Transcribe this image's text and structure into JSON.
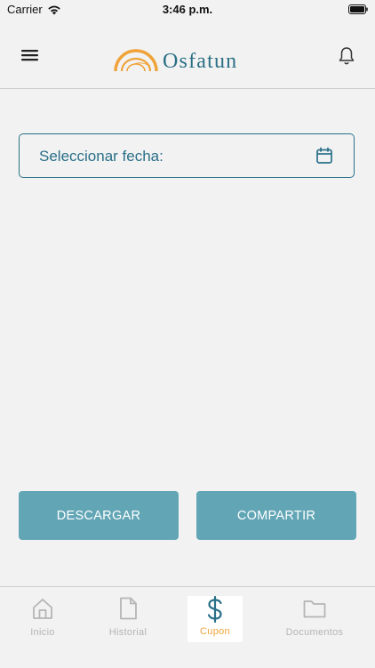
{
  "status_bar": {
    "carrier": "Carrier",
    "time": "3:46 p.m."
  },
  "header": {
    "brand": "Osfatun",
    "logo_colors": {
      "arc": "#f0a33a",
      "text": "#2a6f84"
    }
  },
  "date_selector": {
    "label": "Seleccionar fecha:",
    "icon": "calendar-icon"
  },
  "actions": {
    "download_label": "DESCARGAR",
    "share_label": "COMPARTIR",
    "button_color": "#62a6b6"
  },
  "tab_bar": {
    "active_color": "#f0a33a",
    "inactive_color": "#b5b5b5",
    "items": [
      {
        "label": "Inicio",
        "icon": "home-icon",
        "active": false
      },
      {
        "label": "Historial",
        "icon": "document-icon",
        "active": false
      },
      {
        "label": "Cupon",
        "icon": "dollar-icon",
        "active": true
      },
      {
        "label": "Documentos",
        "icon": "folder-icon",
        "active": false
      }
    ]
  }
}
